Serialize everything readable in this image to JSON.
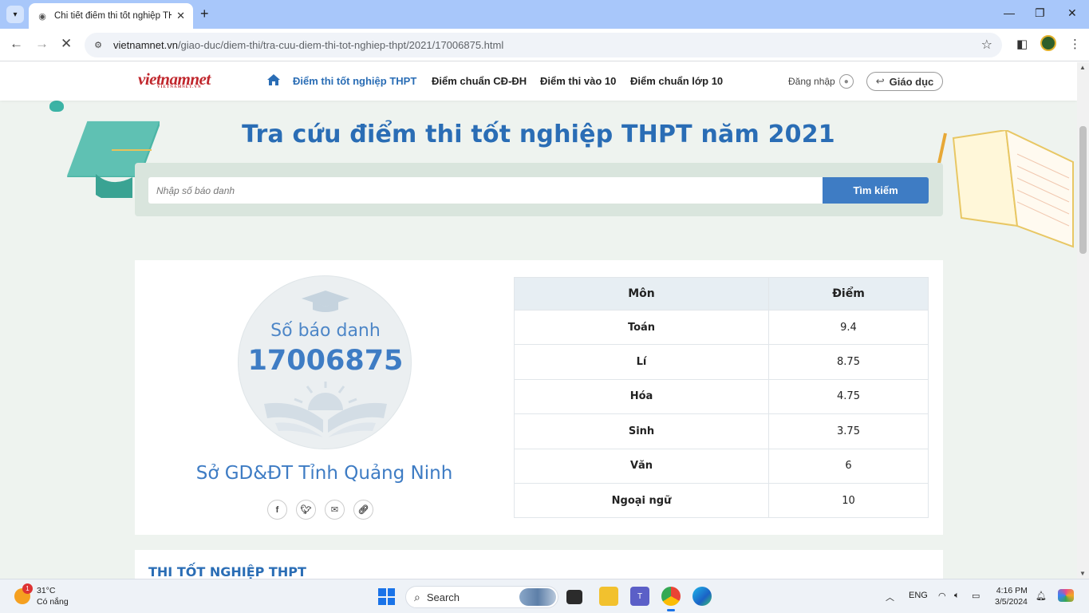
{
  "browser": {
    "tab_title": "Chi tiết điểm thi tốt nghiệp THPT",
    "url_domain": "vietnamnet.vn",
    "url_path": "/giao-duc/diem-thi/tra-cuu-diem-thi-tot-nghiep-thpt/2021/17006875.html"
  },
  "header": {
    "logo_text": "vietnamnet",
    "logo_sub": "VIETNAMNET.VN",
    "nav": [
      {
        "label": "Điểm thi tốt nghiệp THPT",
        "active": true
      },
      {
        "label": "Điểm chuẩn CĐ-ĐH",
        "active": false
      },
      {
        "label": "Điểm thi vào 10",
        "active": false
      },
      {
        "label": "Điểm chuẩn lớp 10",
        "active": false
      }
    ],
    "login_label": "Đăng nhập",
    "category_label": "Giáo dục"
  },
  "hero": {
    "title": "Tra cứu điểm thi tốt nghiệp THPT năm 2021",
    "search_placeholder": "Nhập số báo danh",
    "search_button": "Tìm kiếm"
  },
  "result": {
    "badge_caption": "Số báo danh",
    "candidate_number": "17006875",
    "department": "Sở GD&ĐT Tỉnh Quảng Ninh",
    "table": {
      "col_subject": "Môn",
      "col_score": "Điểm",
      "rows": [
        {
          "subject": "Toán",
          "score": "9.4"
        },
        {
          "subject": "Lí",
          "score": "8.75"
        },
        {
          "subject": "Hóa",
          "score": "4.75"
        },
        {
          "subject": "Sinh",
          "score": "3.75"
        },
        {
          "subject": "Văn",
          "score": "6"
        },
        {
          "subject": "Ngoại ngữ",
          "score": "10"
        }
      ]
    },
    "share_icons": [
      "facebook-icon",
      "twitter-icon",
      "email-icon",
      "link-icon"
    ]
  },
  "section": {
    "title": "THI TỐT NGHIỆP THPT"
  },
  "taskbar": {
    "weather_temp": "31°C",
    "weather_desc": "Có nắng",
    "weather_badge": "1",
    "search_label": "Search",
    "language": "ENG",
    "time": "4:16 PM",
    "date": "3/5/2024"
  },
  "colors": {
    "brand_blue": "#2a6db5",
    "button_blue": "#3e7cc4",
    "logo_red": "#c0262c"
  }
}
